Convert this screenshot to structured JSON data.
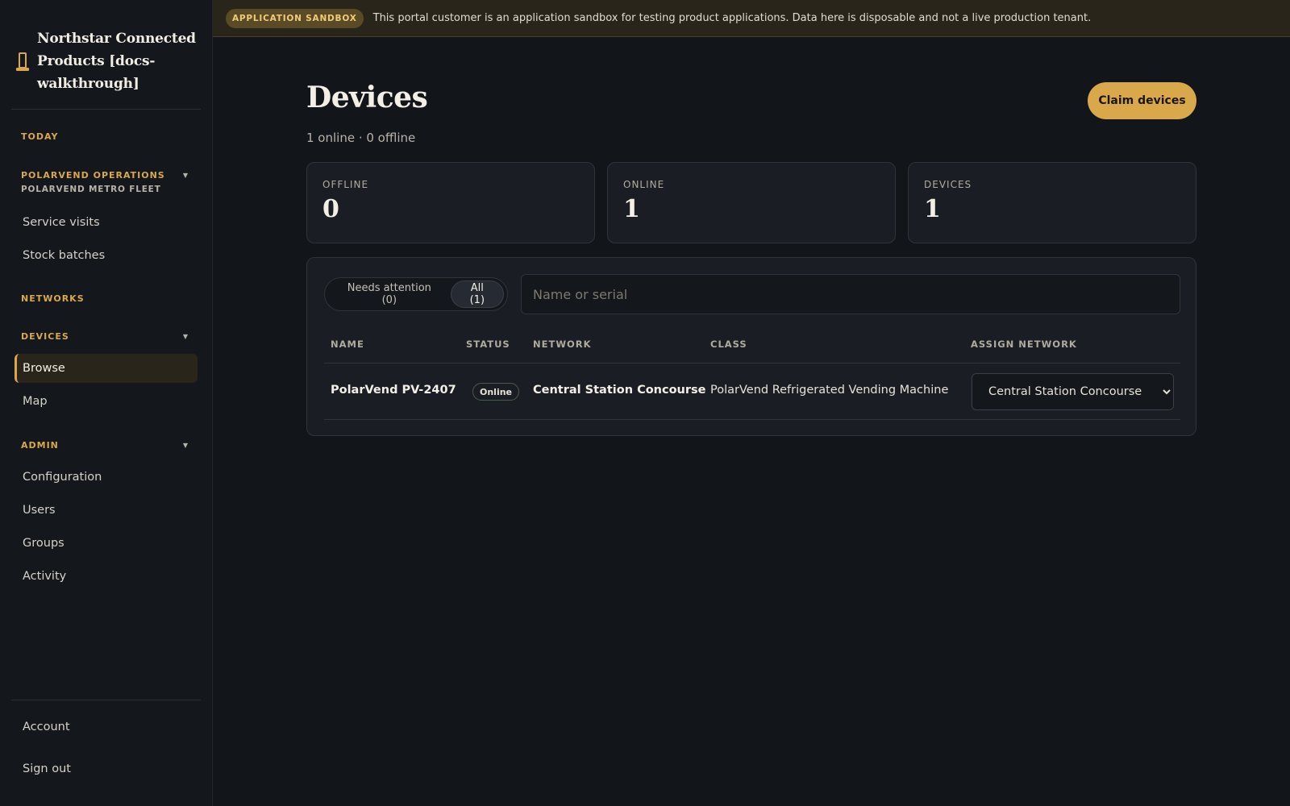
{
  "banner": {
    "badge": "APPLICATION SANDBOX",
    "text": "This portal customer is an application sandbox for testing product applications. Data here is disposable and not a live production tenant."
  },
  "brand": {
    "title": "Northstar Connected Products [docs-walkthrough]",
    "icon": "vending-machine-icon"
  },
  "sidebar": {
    "today": "TODAY",
    "operations": "POLARVEND OPERATIONS",
    "fleet": "POLARVEND METRO FLEET",
    "service_visits": "Service visits",
    "stock_batches": "Stock batches",
    "networks": "NETWORKS",
    "devices": "DEVICES",
    "browse": "Browse",
    "map": "Map",
    "admin": "ADMIN",
    "configuration": "Configuration",
    "users": "Users",
    "groups": "Groups",
    "activity": "Activity",
    "account": "Account",
    "sign_out": "Sign out"
  },
  "page": {
    "title": "Devices",
    "subtitle": "1 online · 0 offline",
    "claim_label": "Claim devices"
  },
  "stats": [
    {
      "label": "OFFLINE",
      "value": "0"
    },
    {
      "label": "ONLINE",
      "value": "1"
    },
    {
      "label": "DEVICES",
      "value": "1"
    }
  ],
  "filters": {
    "needs_attention": "Needs attention (0)",
    "all": "All (1)"
  },
  "search": {
    "placeholder": "Name or serial"
  },
  "table": {
    "headers": {
      "name": "NAME",
      "status": "STATUS",
      "network": "NETWORK",
      "class": "CLASS",
      "assign": "ASSIGN NETWORK"
    },
    "rows": [
      {
        "name": "PolarVend PV-2407",
        "status": "Online",
        "network": "Central Station Concourse",
        "class": "PolarVend Refrigerated Vending Machine",
        "assign": "Central Station Concourse"
      }
    ]
  },
  "colors": {
    "accent": "#d9a84a",
    "background": "#12151a",
    "sidebar": "#14171c",
    "card": "#1a1e24"
  }
}
